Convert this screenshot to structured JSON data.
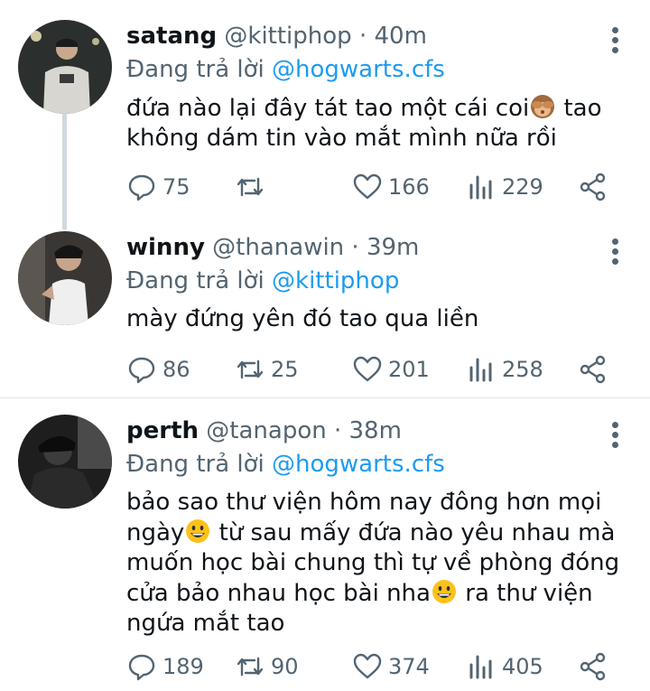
{
  "tweets": [
    {
      "name": "satang",
      "handle": "@kittiphop",
      "time": "40m",
      "reply_prefix": "Đang trả lời ",
      "reply_to": "@hogwarts.cfs",
      "text_lines": [
        "đứa nào lại đây tát tao một cái coi",
        " tao",
        "không dám tin vào mắt mình nữa rồi"
      ],
      "emoji": "see-no-evil-monkey-emoji",
      "replies": "75",
      "retweets": "",
      "likes": "166",
      "views": "229"
    },
    {
      "name": "winny",
      "handle": "@thanawin",
      "time": "39m",
      "reply_prefix": "Đang trả lời ",
      "reply_to": "@kittiphop",
      "text_lines": [
        "mày đứng yên đó tao qua liền"
      ],
      "replies": "86",
      "retweets": "25",
      "likes": "201",
      "views": "258"
    },
    {
      "name": "perth",
      "handle": "@tanapon",
      "time": "38m",
      "reply_prefix": "Đang trả lời ",
      "reply_to": "@hogwarts.cfs",
      "text_lines": [
        "bảo sao thư viện hôm nay đông hơn mọi",
        "ngày",
        " từ sau mấy đứa nào yêu nhau mà",
        "muốn học bài chung thì tự về phòng đóng",
        "cửa bảo nhau học bài nha",
        " ra thư viện",
        "ngứa mắt tao"
      ],
      "emoji": "grinning-face-emoji",
      "replies": "189",
      "retweets": "90",
      "likes": "374",
      "views": "405"
    }
  ],
  "separator": " · ",
  "colors": {
    "mention": "#1d9bf0",
    "muted": "#536471",
    "text": "#0f1419",
    "thread_line": "#cfd9de"
  }
}
